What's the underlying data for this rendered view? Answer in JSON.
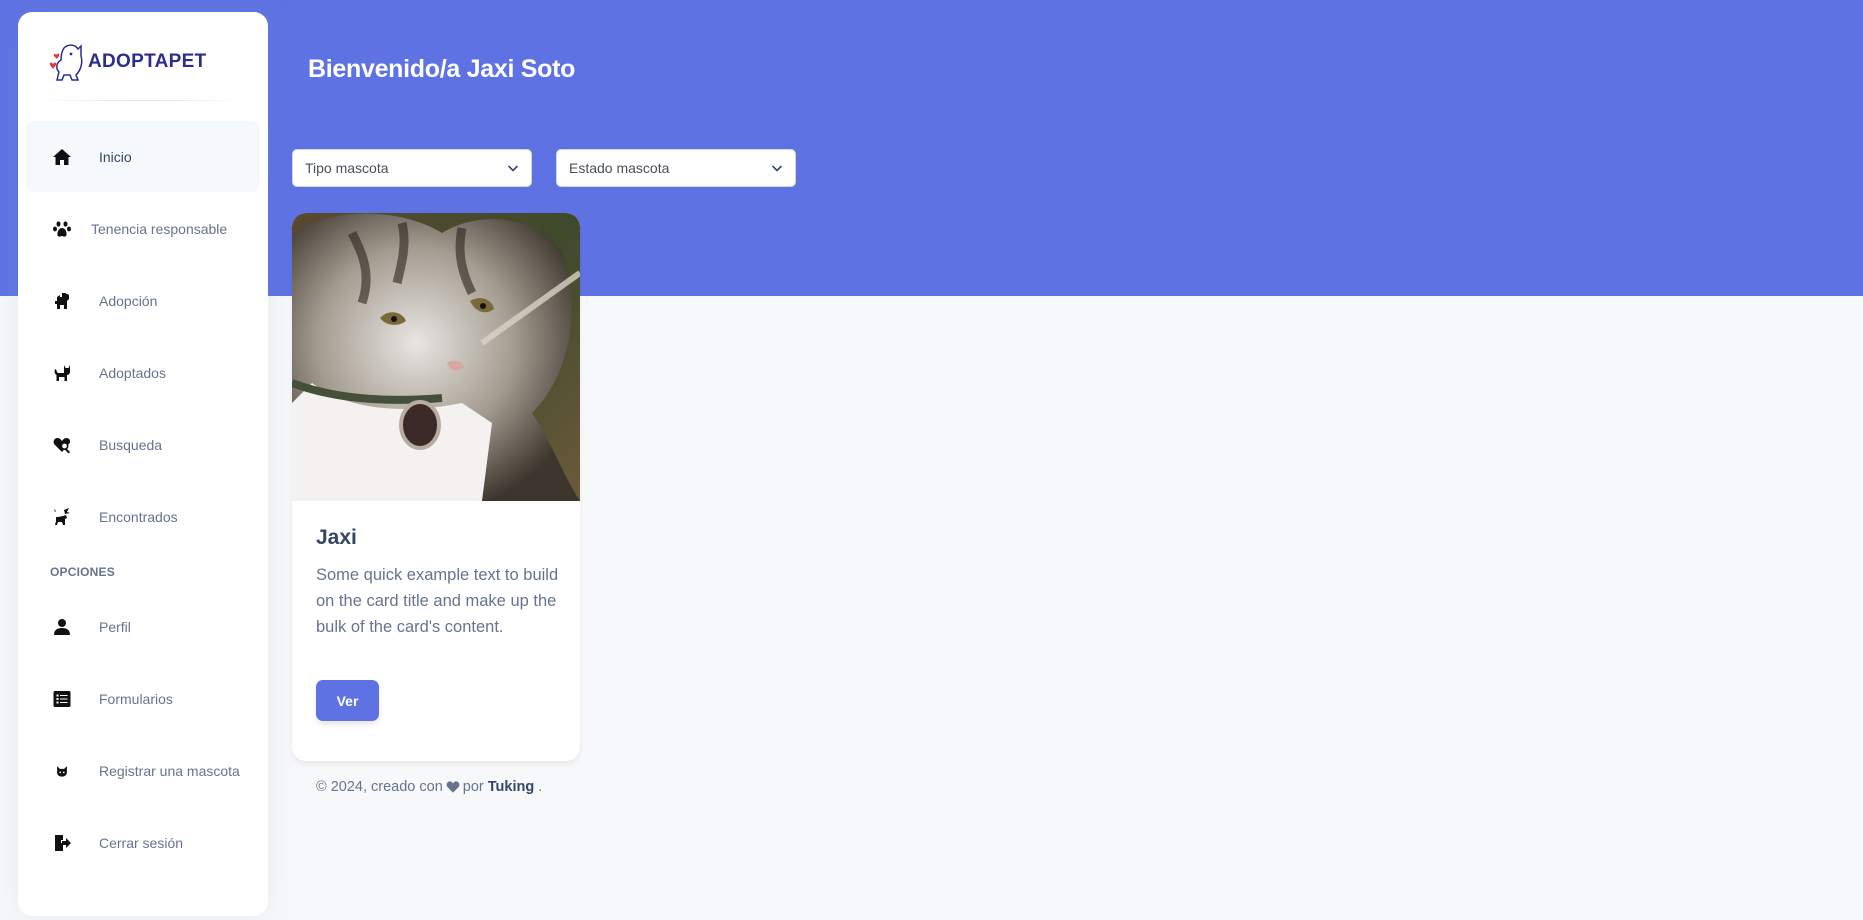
{
  "brand": {
    "name": "ADOPTAPET",
    "logo_icon": "dog-cat-heart-logo"
  },
  "sidebar": {
    "items": [
      {
        "label": "Inicio",
        "icon": "home-icon",
        "active": true
      },
      {
        "label": "Tenencia responsable",
        "icon": "paw-icon"
      },
      {
        "label": "Adopción",
        "icon": "dog-icon"
      },
      {
        "label": "Adoptados",
        "icon": "cat-icon"
      },
      {
        "label": "Busqueda",
        "icon": "heart-search-icon"
      },
      {
        "label": "Encontrados",
        "icon": "dog-bird-icon"
      }
    ],
    "options_heading": "OPCIONES",
    "options": [
      {
        "label": "Perfil",
        "icon": "user-icon"
      },
      {
        "label": "Formularios",
        "icon": "list-form-icon"
      },
      {
        "label": "Registrar una mascota",
        "icon": "cat-face-icon"
      },
      {
        "label": "Cerrar sesión",
        "icon": "logout-icon"
      }
    ]
  },
  "header": {
    "welcome": "Bienvenido/a Jaxi Soto"
  },
  "filters": {
    "tipo": {
      "selected": "Tipo mascota"
    },
    "estado": {
      "selected": "Estado mascota"
    }
  },
  "card": {
    "title": "Jaxi",
    "text": "Some quick example text to build on the card title and make up the bulk of the card's content.",
    "button": "Ver",
    "image": "tabby-cat-photo"
  },
  "footer": {
    "prefix": "© 2024, creado con",
    "middle": "por",
    "author": "Tuking",
    "suffix": "."
  },
  "colors": {
    "primary": "#5e72e4",
    "brand_text": "#2d2d8a",
    "text_muted": "#67748e",
    "text_dark": "#344767",
    "background": "#f7f8fa"
  }
}
